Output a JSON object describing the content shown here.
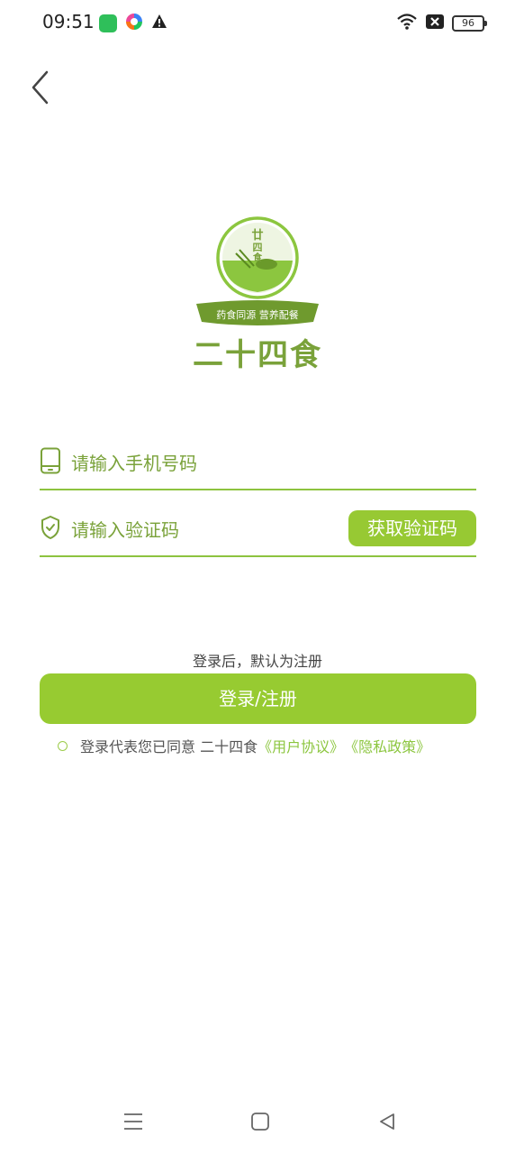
{
  "status_bar": {
    "time": "09:51",
    "battery": "96",
    "icons": [
      "app-green-icon",
      "app-colorful-icon",
      "warning-icon",
      "wifi-icon",
      "signal-off-icon",
      "battery-icon"
    ]
  },
  "logo": {
    "badge_text": "廿四食",
    "ribbon_text": "药食同源 营养配餐"
  },
  "brand": {
    "name": "二十四食"
  },
  "form": {
    "phone_placeholder": "请输入手机号码",
    "code_placeholder": "请输入验证码",
    "get_code_label": "获取验证码"
  },
  "hint": "登录后，默认为注册",
  "login_label": "登录/注册",
  "agreement": {
    "prefix": "登录代表您已同意 二十四食",
    "user_agreement": "《用户协议》",
    "privacy_policy": "《隐私政策》"
  },
  "colors": {
    "accent": "#97cb31",
    "accent_dark": "#7aa23a",
    "line": "#8dc33f"
  }
}
